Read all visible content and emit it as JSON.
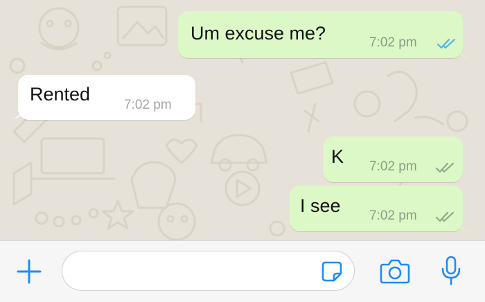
{
  "colors": {
    "outgoing_bubble": "#dcf8c6",
    "incoming_bubble": "#ffffff",
    "accent_blue": "#1f8bf5",
    "read_tick_blue": "#4fb6ec",
    "delivered_tick_grey": "#92a58c"
  },
  "messages": [
    {
      "direction": "outgoing",
      "text": "Um excuse me?",
      "time": "7:02 pm",
      "status": "read",
      "status_icon": "double-check-blue-icon"
    },
    {
      "direction": "incoming",
      "text": "Rented",
      "time": "7:02 pm"
    },
    {
      "direction": "outgoing",
      "text": "K",
      "time": "7:02 pm",
      "status": "delivered",
      "status_icon": "double-check-grey-icon"
    },
    {
      "direction": "outgoing",
      "text": "I see",
      "time": "7:02 pm",
      "status": "delivered",
      "status_icon": "double-check-grey-icon"
    }
  ],
  "composer": {
    "placeholder": "",
    "value": "",
    "icons": [
      "plus-icon",
      "sticker-icon",
      "camera-icon",
      "microphone-icon"
    ]
  }
}
